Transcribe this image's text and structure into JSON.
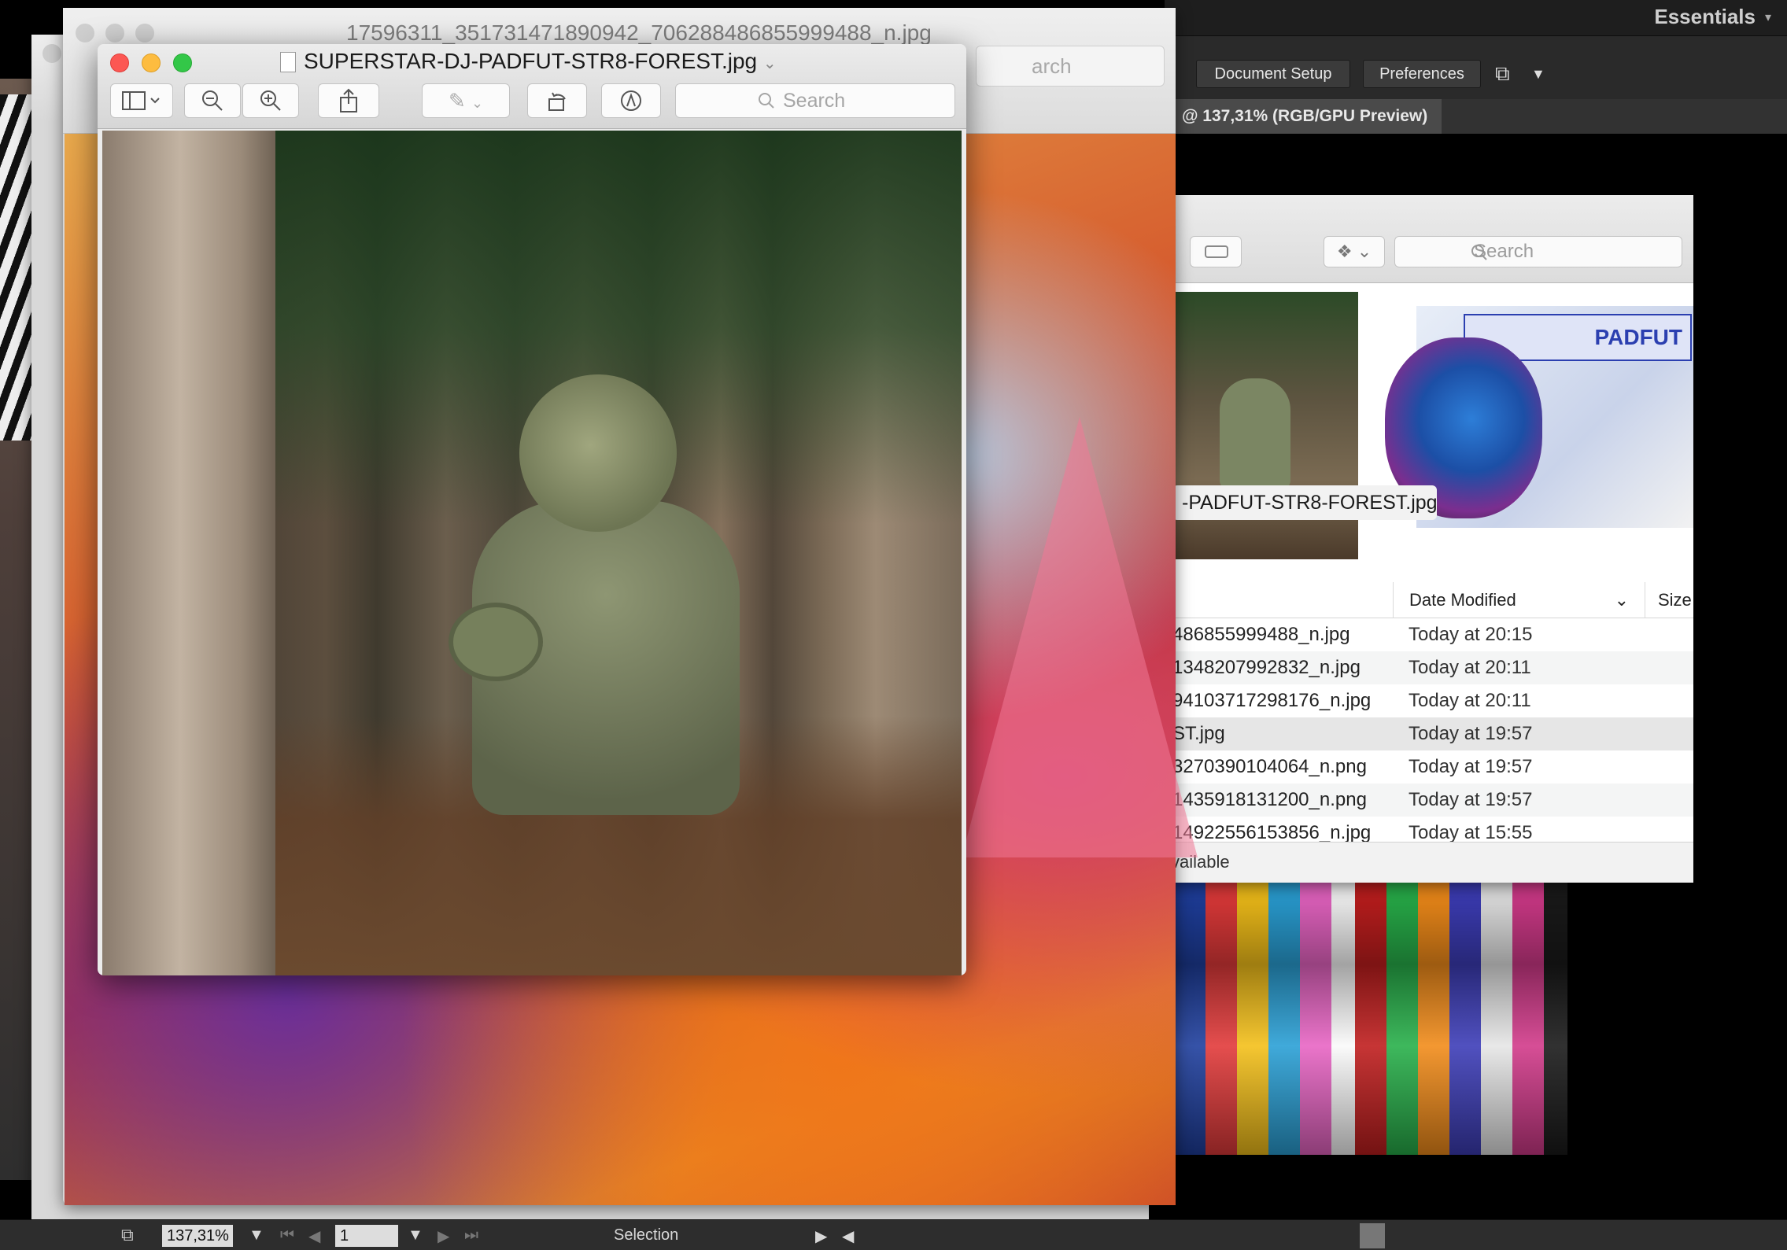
{
  "illustrator": {
    "workspace": "Essentials",
    "buttons": {
      "document_setup": "Document Setup",
      "preferences": "Preferences"
    },
    "doc_tab": "@ 137,31% (RGB/GPU Preview)",
    "status": {
      "zoom": "137,31%",
      "artboard": "1",
      "tool": "Selection"
    }
  },
  "back_preview_window": {
    "title": "17596311_351731471890942_7062884868559994​88_n.jpg",
    "search_fragment": "arch"
  },
  "front_preview_window": {
    "title": "SUPERSTAR-DJ-PADFUT-STR8-FOREST.jpg",
    "search_placeholder": "Search",
    "toolbar_icons": [
      "sidebar-icon",
      "zoom-out-icon",
      "zoom-in-icon",
      "share-icon",
      "markup-pen-icon",
      "rotate-icon",
      "annotate-icon"
    ]
  },
  "finder": {
    "search_placeholder": "Search",
    "gallery_caption": "-PADFUT-STR8-FOREST.jpg",
    "thumb2_banner": "PADFUT",
    "columns": {
      "date": "Date Modified",
      "size": "Size"
    },
    "rows": [
      {
        "name": "486855999488_n.jpg",
        "date": "Today at 20:15"
      },
      {
        "name": "1348207992832_n.jpg",
        "date": "Today at 20:11"
      },
      {
        "name": "94103717298176_n.jpg",
        "date": "Today at 20:11"
      },
      {
        "name": "ST.jpg",
        "date": "Today at 19:57",
        "selected": true
      },
      {
        "name": "3270390104064_n.png",
        "date": "Today at 19:57"
      },
      {
        "name": "1435918131200_n.png",
        "date": "Today at 19:57"
      },
      {
        "name": "14922556153856_n.jpg",
        "date": "Today at 15:55"
      }
    ],
    "status": "vailable"
  },
  "colors": {
    "close": "#fc5753",
    "minimize": "#fdbc40",
    "zoom": "#33c748",
    "illustrator_bg": "#2a2a2a"
  }
}
